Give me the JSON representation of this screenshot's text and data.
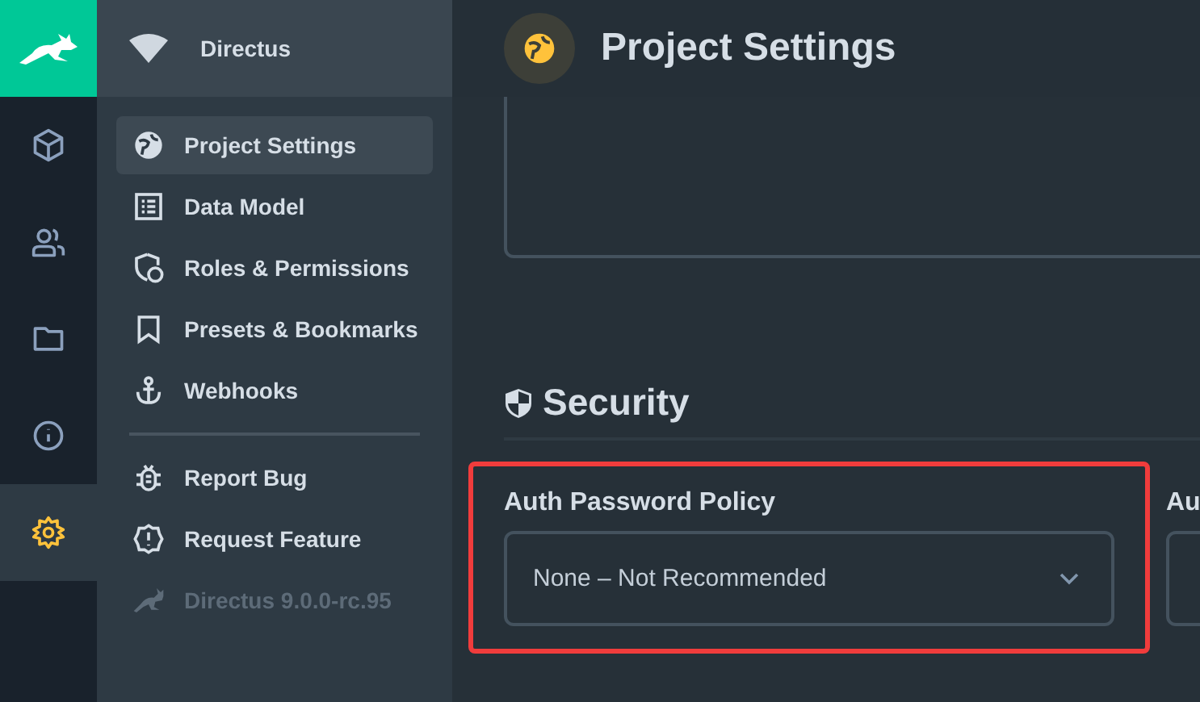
{
  "rail": {
    "items": [
      {
        "selected": false
      },
      {
        "selected": false
      },
      {
        "selected": false
      },
      {
        "selected": false
      },
      {
        "selected": true
      }
    ]
  },
  "nav": {
    "project": "Directus",
    "items": [
      {
        "label": "Project Settings",
        "selected": true
      },
      {
        "label": "Data Model",
        "selected": false
      },
      {
        "label": "Roles & Permissions",
        "selected": false
      },
      {
        "label": "Presets & Bookmarks",
        "selected": false
      },
      {
        "label": "Webhooks",
        "selected": false
      }
    ],
    "links": [
      {
        "label": "Report Bug",
        "disabled": false
      },
      {
        "label": "Request Feature",
        "disabled": false
      },
      {
        "label": "Directus 9.0.0-rc.95",
        "disabled": true
      }
    ]
  },
  "header": {
    "title": "Project Settings"
  },
  "section": {
    "title": "Security"
  },
  "fields": [
    {
      "label": "Auth Password Policy",
      "value": "None – Not Recommended",
      "highlighted": true
    },
    {
      "label": "Au",
      "highlighted": false
    }
  ]
}
